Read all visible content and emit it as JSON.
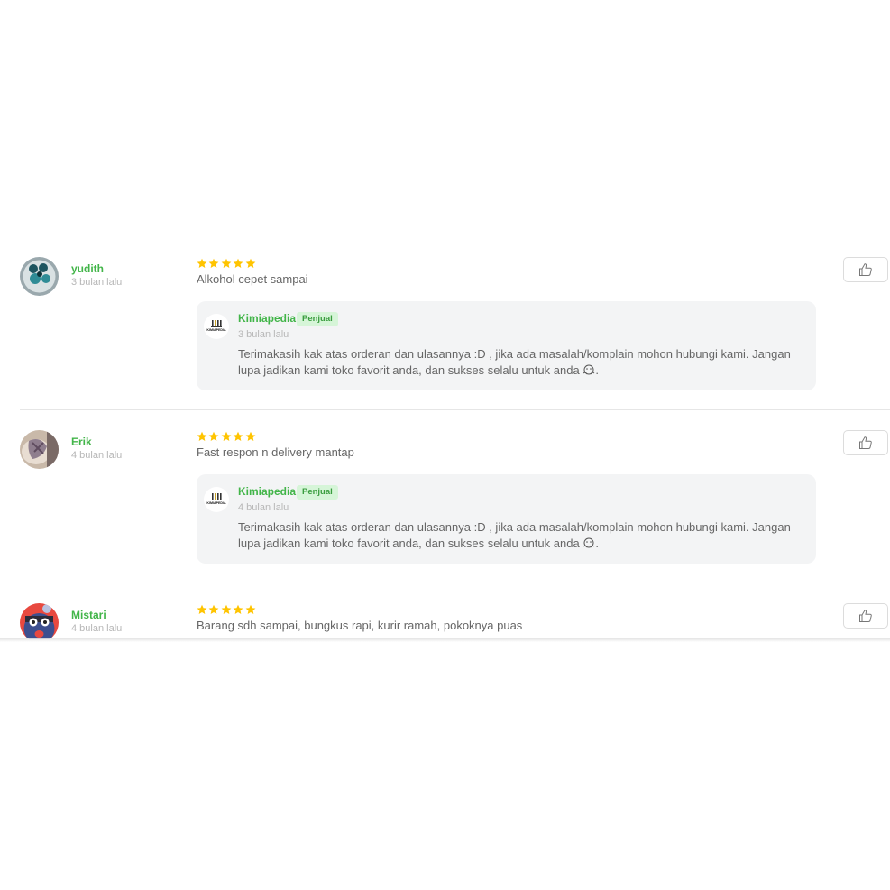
{
  "colors": {
    "reviewer_name": "#42b549",
    "star": "#ffc400",
    "badge_bg": "#d6f5d8",
    "reply_bg": "#f3f4f5"
  },
  "reviews": [
    {
      "name": "yudith",
      "time": "3 bulan lalu",
      "rating": 5,
      "text": "Alkohol cepet sampai",
      "reply": {
        "seller": "Kimiapedia",
        "badge": "Penjual",
        "time": "3 bulan lalu",
        "logo_text": "KIMIAPEDIA",
        "text": "Terimakasih kak atas orderan dan ulasannya :D , jika ada masalah/komplain mohon hubungi kami. Jangan lupa jadikan kami toko favorit anda, dan sukses selalu untuk anda",
        "text_end": "."
      }
    },
    {
      "name": "Erik",
      "time": "4 bulan lalu",
      "rating": 5,
      "text": "Fast respon n delivery mantap",
      "reply": {
        "seller": "Kimiapedia",
        "badge": "Penjual",
        "time": "4 bulan lalu",
        "logo_text": "KIMIAPEDIA",
        "text": "Terimakasih kak atas orderan dan ulasannya :D , jika ada masalah/komplain mohon hubungi kami. Jangan lupa jadikan kami toko favorit anda, dan sukses selalu untuk anda",
        "text_end": "."
      }
    },
    {
      "name": "Mistari",
      "time": "4 bulan lalu",
      "rating": 5,
      "text": "Barang sdh sampai, bungkus rapi, kurir ramah, pokoknya puas"
    }
  ]
}
